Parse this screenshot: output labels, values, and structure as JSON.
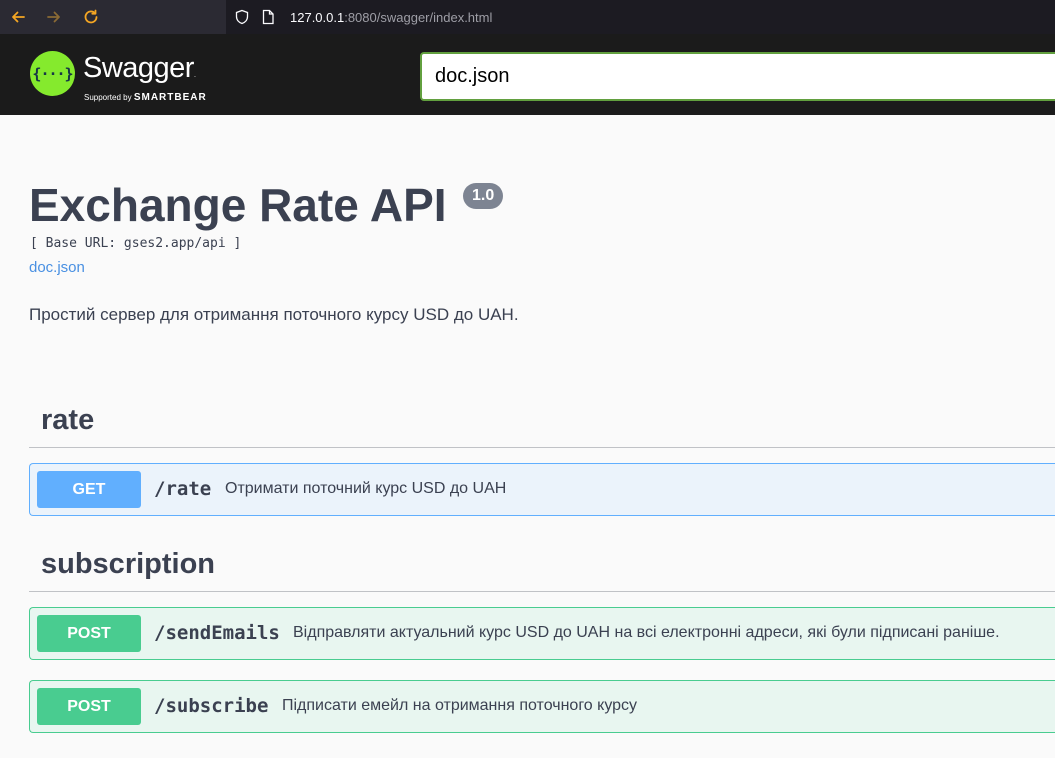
{
  "browser": {
    "url_host": "127.0.0.1",
    "url_rest": ":8080/swagger/index.html"
  },
  "topbar": {
    "logo_word": "Swagger",
    "logo_tm": ".",
    "logo_sub_prefix": "Supported by",
    "logo_sub_brand": "SMARTBEAR",
    "spec_url": "doc.json"
  },
  "info": {
    "title": "Exchange Rate API",
    "version": "1.0",
    "base_url": "[ Base URL: gses2.app/api ]",
    "spec_link": "doc.json",
    "description": "Простий сервер для отримання поточного курсу USD до UAH."
  },
  "tags": [
    {
      "name": "rate",
      "operations": [
        {
          "method": "GET",
          "path": "/rate",
          "summary": "Отримати поточний курс USD до UAH"
        }
      ]
    },
    {
      "name": "subscription",
      "operations": [
        {
          "method": "POST",
          "path": "/sendEmails",
          "summary": "Відправляти актуальний курс USD до UAH на всі електронні адреси, які були підписані раніше."
        },
        {
          "method": "POST",
          "path": "/subscribe",
          "summary": "Підписати емейл на отримання поточного курсу"
        }
      ]
    }
  ],
  "colors": {
    "get": "#61affe",
    "post": "#49cc90",
    "swagger_green": "#85ea2d",
    "topbar": "#1b1b1b"
  }
}
